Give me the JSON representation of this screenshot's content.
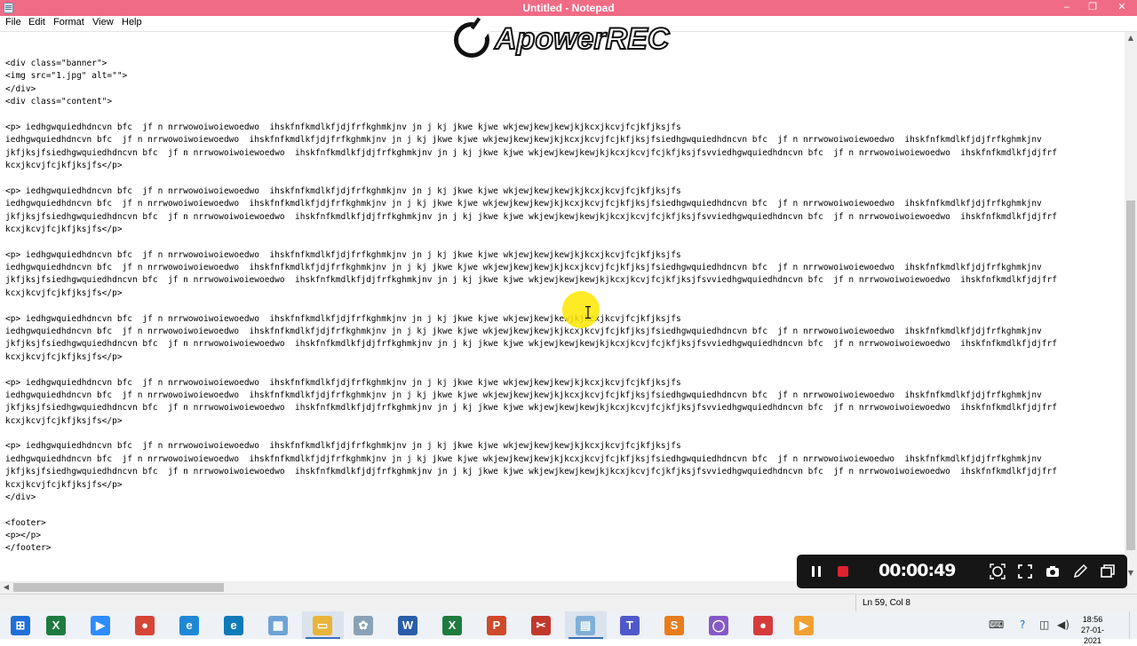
{
  "window": {
    "title": "Untitled - Notepad",
    "controls": {
      "minimize": "–",
      "maximize": "❐",
      "close": "✕"
    }
  },
  "menu": {
    "items": [
      {
        "label": "File"
      },
      {
        "label": "Edit"
      },
      {
        "label": "Format"
      },
      {
        "label": "View"
      },
      {
        "label": "Help"
      }
    ]
  },
  "editor": {
    "lines": [
      {
        "text": "<div class=\"banner\">"
      },
      {
        "text": "<img src=\"1.jpg\" alt=\"\">"
      },
      {
        "text": "</div>"
      },
      {
        "text": "<div class=\"content\">"
      },
      {
        "text": ""
      },
      {
        "text": "<p> iedhgwquiedhdncvn bfc  jf n nrrwowoiwoiewoedwo  ihskfnfkmdlkfjdjfrfkghmkjnv jn j kj jkwe kjwe wkjewjkewjkewjkjkcxjkcvjfcjkfjksjfs"
      },
      {
        "text": "iedhgwquiedhdncvn bfc  jf n nrrwowoiwoiewoedwo  ihskfnfkmdlkfjdjfrfkghmkjnv jn j kj jkwe kjwe wkjewjkewjkewjkjkcxjkcvjfcjkfjksjfsiedhgwquiedhdncvn bfc  jf n nrrwowoiwoiewoedwo  ihskfnfkmdlkfjdjfrfkghmkjnv"
      },
      {
        "text": "jkfjksjfsiedhgwquiedhdncvn bfc  jf n nrrwowoiwoiewoedwo  ihskfnfkmdlkfjdjfrfkghmkjnv jn j kj jkwe kjwe wkjewjkewjkewjkjkcxjkcvjfcjkfjksjfsvviedhgwquiedhdncvn bfc  jf n nrrwowoiwoiewoedwo  ihskfnfkmdlkfjdjfrf"
      },
      {
        "text": "kcxjkcvjfcjkfjksjfs</p>"
      },
      {
        "text": ""
      },
      {
        "text": "<p> iedhgwquiedhdncvn bfc  jf n nrrwowoiwoiewoedwo  ihskfnfkmdlkfjdjfrfkghmkjnv jn j kj jkwe kjwe wkjewjkewjkewjkjkcxjkcvjfcjkfjksjfs"
      },
      {
        "text": "iedhgwquiedhdncvn bfc  jf n nrrwowoiwoiewoedwo  ihskfnfkmdlkfjdjfrfkghmkjnv jn j kj jkwe kjwe wkjewjkewjkewjkjkcxjkcvjfcjkfjksjfsiedhgwquiedhdncvn bfc  jf n nrrwowoiwoiewoedwo  ihskfnfkmdlkfjdjfrfkghmkjnv"
      },
      {
        "text": "jkfjksjfsiedhgwquiedhdncvn bfc  jf n nrrwowoiwoiewoedwo  ihskfnfkmdlkfjdjfrfkghmkjnv jn j kj jkwe kjwe wkjewjkewjkewjkjkcxjkcvjfcjkfjksjfsvviedhgwquiedhdncvn bfc  jf n nrrwowoiwoiewoedwo  ihskfnfkmdlkfjdjfrf"
      },
      {
        "text": "kcxjkcvjfcjkfjksjfs</p>"
      },
      {
        "text": ""
      },
      {
        "text": "<p> iedhgwquiedhdncvn bfc  jf n nrrwowoiwoiewoedwo  ihskfnfkmdlkfjdjfrfkghmkjnv jn j kj jkwe kjwe wkjewjkewjkewjkjkcxjkcvjfcjkfjksjfs"
      },
      {
        "text": "iedhgwquiedhdncvn bfc  jf n nrrwowoiwoiewoedwo  ihskfnfkmdlkfjdjfrfkghmkjnv jn j kj jkwe kjwe wkjewjkewjkewjkjkcxjkcvjfcjkfjksjfsiedhgwquiedhdncvn bfc  jf n nrrwowoiwoiewoedwo  ihskfnfkmdlkfjdjfrfkghmkjnv"
      },
      {
        "text": "jkfjksjfsiedhgwquiedhdncvn bfc  jf n nrrwowoiwoiewoedwo  ihskfnfkmdlkfjdjfrfkghmkjnv jn j kj jkwe kjwe wkjewjkewjkewjkjkcxjkcvjfcjkfjksjfsvviedhgwquiedhdncvn bfc  jf n nrrwowoiwoiewoedwo  ihskfnfkmdlkfjdjfrf"
      },
      {
        "text": "kcxjkcvjfcjkfjksjfs</p>"
      },
      {
        "text": ""
      },
      {
        "text": "<p> iedhgwquiedhdncvn bfc  jf n nrrwowoiwoiewoedwo  ihskfnfkmdlkfjdjfrfkghmkjnv jn j kj jkwe kjwe wkjewjkewjkewjkjkcxjkcvjfcjkfjksjfs"
      },
      {
        "text": "iedhgwquiedhdncvn bfc  jf n nrrwowoiwoiewoedwo  ihskfnfkmdlkfjdjfrfkghmkjnv jn j kj jkwe kjwe wkjewjkewjkewjkjkcxjkcvjfcjkfjksjfsiedhgwquiedhdncvn bfc  jf n nrrwowoiwoiewoedwo  ihskfnfkmdlkfjdjfrfkghmkjnv"
      },
      {
        "text": "jkfjksjfsiedhgwquiedhdncvn bfc  jf n nrrwowoiwoiewoedwo  ihskfnfkmdlkfjdjfrfkghmkjnv jn j kj jkwe kjwe wkjewjkewjkewjkjkcxjkcvjfcjkfjksjfsvviedhgwquiedhdncvn bfc  jf n nrrwowoiwoiewoedwo  ihskfnfkmdlkfjdjfrf"
      },
      {
        "text": "kcxjkcvjfcjkfjksjfs</p>"
      },
      {
        "text": ""
      },
      {
        "text": "<p> iedhgwquiedhdncvn bfc  jf n nrrwowoiwoiewoedwo  ihskfnfkmdlkfjdjfrfkghmkjnv jn j kj jkwe kjwe wkjewjkewjkewjkjkcxjkcvjfcjkfjksjfs"
      },
      {
        "text": "iedhgwquiedhdncvn bfc  jf n nrrwowoiwoiewoedwo  ihskfnfkmdlkfjdjfrfkghmkjnv jn j kj jkwe kjwe wkjewjkewjkewjkjkcxjkcvjfcjkfjksjfsiedhgwquiedhdncvn bfc  jf n nrrwowoiwoiewoedwo  ihskfnfkmdlkfjdjfrfkghmkjnv"
      },
      {
        "text": "jkfjksjfsiedhgwquiedhdncvn bfc  jf n nrrwowoiwoiewoedwo  ihskfnfkmdlkfjdjfrfkghmkjnv jn j kj jkwe kjwe wkjewjkewjkewjkjkcxjkcvjfcjkfjksjfsvviedhgwquiedhdncvn bfc  jf n nrrwowoiwoiewoedwo  ihskfnfkmdlkfjdjfrf"
      },
      {
        "text": "kcxjkcvjfcjkfjksjfs</p>"
      },
      {
        "text": ""
      },
      {
        "text": "<p> iedhgwquiedhdncvn bfc  jf n nrrwowoiwoiewoedwo  ihskfnfkmdlkfjdjfrfkghmkjnv jn j kj jkwe kjwe wkjewjkewjkewjkjkcxjkcvjfcjkfjksjfs"
      },
      {
        "text": "iedhgwquiedhdncvn bfc  jf n nrrwowoiwoiewoedwo  ihskfnfkmdlkfjdjfrfkghmkjnv jn j kj jkwe kjwe wkjewjkewjkewjkjkcxjkcvjfcjkfjksjfsiedhgwquiedhdncvn bfc  jf n nrrwowoiwoiewoedwo  ihskfnfkmdlkfjdjfrfkghmkjnv"
      },
      {
        "text": "jkfjksjfsiedhgwquiedhdncvn bfc  jf n nrrwowoiwoiewoedwo  ihskfnfkmdlkfjdjfrfkghmkjnv jn j kj jkwe kjwe wkjewjkewjkewjkjkcxjkcvjfcjkfjksjfsvviedhgwquiedhdncvn bfc  jf n nrrwowoiwoiewoedwo  ihskfnfkmdlkfjdjfrf"
      },
      {
        "text": "kcxjkcvjfcjkfjksjfs</p>"
      },
      {
        "text": "</div>"
      },
      {
        "text": ""
      },
      {
        "text": "<footer>"
      },
      {
        "text": "<p></p>"
      },
      {
        "text": "</footer>"
      }
    ]
  },
  "status": {
    "position": "Ln 59, Col 8"
  },
  "watermark": {
    "text": "ApowerREC"
  },
  "recorder": {
    "timer": "00:00:49",
    "buttons": [
      {
        "name": "pause-icon"
      },
      {
        "name": "stop-record-icon"
      },
      {
        "name": "crosshair-icon"
      },
      {
        "name": "fullscreen-icon"
      },
      {
        "name": "camera-icon"
      },
      {
        "name": "pen-icon"
      },
      {
        "name": "window-icon"
      }
    ]
  },
  "taskbar": {
    "apps": [
      {
        "name": "start-icon",
        "color": "#1f6fd6",
        "glyph": "⊞"
      },
      {
        "name": "excel-icon",
        "color": "#1e7b3f",
        "glyph": "X"
      },
      {
        "name": "zoom-icon",
        "color": "#2d8cff",
        "glyph": "▶"
      },
      {
        "name": "chrome-icon",
        "color": "#d64535",
        "glyph": "●"
      },
      {
        "name": "ie-icon",
        "color": "#1e88d7",
        "glyph": "e"
      },
      {
        "name": "edge-icon",
        "color": "#0f7ab8",
        "glyph": "e"
      },
      {
        "name": "paint-icon",
        "color": "#6fa3d6",
        "glyph": "▦"
      },
      {
        "name": "file-explorer-icon",
        "color": "#e8b43a",
        "glyph": "▭"
      },
      {
        "name": "browser-icon",
        "color": "#8aa2b5",
        "glyph": "✿"
      },
      {
        "name": "word-icon",
        "color": "#2a5ea8",
        "glyph": "W"
      },
      {
        "name": "excel2-icon",
        "color": "#1e7b3f",
        "glyph": "X"
      },
      {
        "name": "powerpoint-icon",
        "color": "#cf4a2b",
        "glyph": "P"
      },
      {
        "name": "snipping-tool-icon",
        "color": "#c0392b",
        "glyph": "✂"
      },
      {
        "name": "notepad-icon",
        "color": "#7fb0d8",
        "glyph": "▤"
      },
      {
        "name": "teams-icon",
        "color": "#5059c9",
        "glyph": "T"
      },
      {
        "name": "sublime-icon",
        "color": "#e87c1d",
        "glyph": "S"
      },
      {
        "name": "chat-icon",
        "color": "#8659c7",
        "glyph": "◯"
      },
      {
        "name": "recorder-icon",
        "color": "#d63b3b",
        "glyph": "●"
      },
      {
        "name": "media-player-icon",
        "color": "#f1a132",
        "glyph": "▶"
      }
    ],
    "clock_time": "18:56",
    "clock_date": "27-01-2021"
  }
}
